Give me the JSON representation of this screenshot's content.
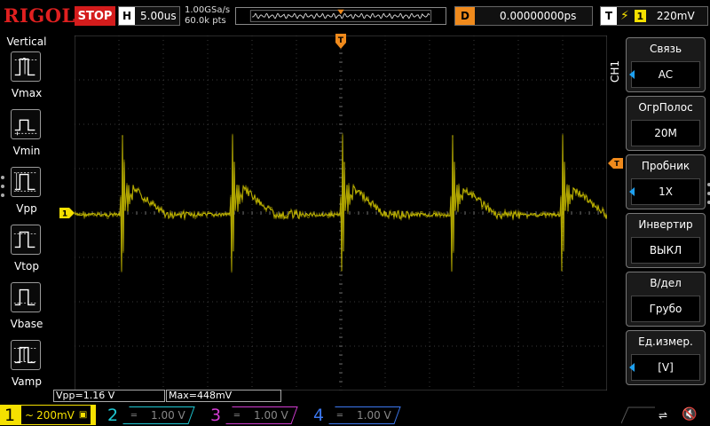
{
  "header": {
    "logo": "RIGOL",
    "run_state": "STOP",
    "timebase": {
      "key": "H",
      "value": "5.00us"
    },
    "sample_rate": "1.00GSa/s",
    "memory_depth": "60.0k pts",
    "delay": {
      "key": "D",
      "value": "0.00000000ps"
    },
    "trigger": {
      "key": "T",
      "source": "1",
      "level": "220mV"
    }
  },
  "left_menu": {
    "title": "Vertical",
    "items": [
      {
        "label": "Vmax"
      },
      {
        "label": "Vmin"
      },
      {
        "label": "Vpp"
      },
      {
        "label": "Vtop"
      },
      {
        "label": "Vbase"
      },
      {
        "label": "Vamp"
      }
    ]
  },
  "channel_menu": {
    "tab": "CH1",
    "items": [
      {
        "title": "Связь",
        "value": "AC",
        "arrow": true
      },
      {
        "title": "ОгрПолос",
        "value": "20M",
        "arrow": false
      },
      {
        "title": "Пробник",
        "value": "1X",
        "arrow": true
      },
      {
        "title": "Инвертир",
        "value": "ВЫКЛ",
        "arrow": false
      },
      {
        "title": "В/дел",
        "value": "Грубо",
        "arrow": false
      },
      {
        "title": "Ед.измер.",
        "value": "[V]",
        "arrow": true
      }
    ]
  },
  "measurements": {
    "vpp": "Vpp=1.16 V",
    "max": "Max=448mV"
  },
  "channels": [
    {
      "num": "1",
      "coupling": "~",
      "scale": "200mV",
      "color": "#f5e000",
      "active": true
    },
    {
      "num": "2",
      "scale": "1.00 V",
      "color": "#1ec8d4",
      "active": false
    },
    {
      "num": "3",
      "scale": "1.00 V",
      "color": "#d23cd2",
      "active": false
    },
    {
      "num": "4",
      "scale": "1.00 V",
      "color": "#3c78f0",
      "active": false
    }
  ],
  "markers": {
    "ch1_ground": "1",
    "trigger_top": "T",
    "trigger_level": "T"
  },
  "colors": {
    "ch1": "#f5e000",
    "trigger": "#f08a1c",
    "accent_blue": "#1ea0f0",
    "stop_red": "#d41c1c"
  }
}
